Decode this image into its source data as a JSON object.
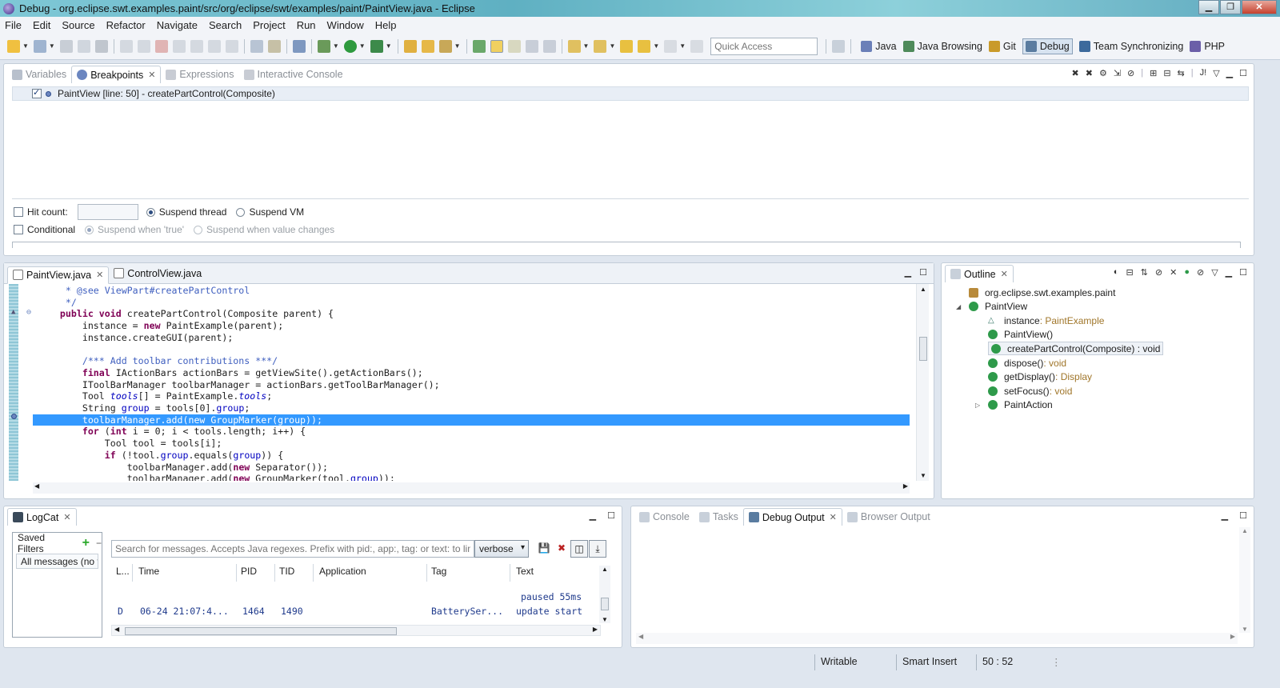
{
  "window": {
    "title": "Debug - org.eclipse.swt.examples.paint/src/org/eclipse/swt/examples/paint/PaintView.java - Eclipse",
    "controls": [
      "▁",
      "❐",
      "✕"
    ]
  },
  "menu": [
    "File",
    "Edit",
    "Source",
    "Refactor",
    "Navigate",
    "Search",
    "Project",
    "Run",
    "Window",
    "Help"
  ],
  "toolbar": {
    "quick_access_placeholder": "Quick Access",
    "perspectives": [
      {
        "label": "Java",
        "color": "#6a7fb8"
      },
      {
        "label": "Java Browsing",
        "color": "#4e8a5a"
      },
      {
        "label": "Git",
        "color": "#c99a2a"
      },
      {
        "label": "Debug",
        "color": "#5a7ca0"
      },
      {
        "label": "Team Synchronizing",
        "color": "#3d6a9c"
      },
      {
        "label": "PHP",
        "color": "#6b5fa8"
      }
    ],
    "active_perspective": "Debug"
  },
  "debug_views": {
    "tabs": [
      {
        "label": "Variables",
        "icon": "variables-icon",
        "active": false
      },
      {
        "label": "Breakpoints",
        "icon": "breakpoints-icon",
        "active": true
      },
      {
        "label": "Expressions",
        "icon": "expressions-icon",
        "active": false
      },
      {
        "label": "Interactive Console",
        "icon": "console-icon",
        "active": false
      }
    ],
    "breakpoint": {
      "label": "PaintView [line: 50] - createPartControl(Composite)",
      "checked": true
    },
    "options": {
      "hit_count_label": "Hit count:",
      "suspend_thread": "Suspend thread",
      "suspend_vm": "Suspend VM",
      "conditional": "Conditional",
      "suspend_true": "Suspend when 'true'",
      "suspend_change": "Suspend when value changes"
    }
  },
  "editor": {
    "tabs": [
      {
        "label": "PaintView.java",
        "active": true
      },
      {
        "label": "ControlView.java",
        "active": false
      }
    ],
    "lines": [
      "     * @see ViewPart#createPartControl",
      "     */",
      "    public void createPartControl(Composite parent) {",
      "        instance = new PaintExample(parent);",
      "        instance.createGUI(parent);",
      "",
      "        /*** Add toolbar contributions ***/",
      "        final IActionBars actionBars = getViewSite().getActionBars();",
      "        IToolBarManager toolbarManager = actionBars.getToolBarManager();",
      "        Tool tools[] = PaintExample.tools;",
      "        String group = tools[0].group;",
      "        toolbarManager.add(new GroupMarker(group));",
      "        for (int i = 0; i < tools.length; i++) {",
      "            Tool tool = tools[i];",
      "            if (!tool.group.equals(group)) {",
      "                toolbarManager.add(new Separator());",
      "                toolbarManager.add(new GroupMarker(tool.group));"
    ],
    "highlighted_line": 11
  },
  "outline": {
    "tab": "Outline",
    "items": [
      {
        "label": "org.eclipse.swt.examples.paint",
        "type": "",
        "indent": 0,
        "icon": "package-icon",
        "color": "#b88a3a"
      },
      {
        "label": "PaintView",
        "type": "",
        "indent": 0,
        "icon": "class-icon",
        "color": "#2e9a4a",
        "expander": "◢"
      },
      {
        "label": "instance",
        "type": " : PaintExample",
        "indent": 1,
        "icon": "field-icon",
        "color": "#3a7a6a"
      },
      {
        "label": "PaintView()",
        "type": "",
        "indent": 1,
        "icon": "constructor-icon",
        "color": "#2e9a4a"
      },
      {
        "label": "createPartControl(Composite) : void",
        "type": "",
        "indent": 1,
        "icon": "method-icon",
        "color": "#2e9a4a",
        "selected": true
      },
      {
        "label": "dispose()",
        "type": " : void",
        "indent": 1,
        "icon": "method-icon",
        "color": "#2e9a4a"
      },
      {
        "label": "getDisplay()",
        "type": " : Display",
        "indent": 1,
        "icon": "method-icon",
        "color": "#2e9a4a"
      },
      {
        "label": "setFocus()",
        "type": " : void",
        "indent": 1,
        "icon": "method-icon",
        "color": "#2e9a4a"
      },
      {
        "label": "PaintAction",
        "type": "",
        "indent": 1,
        "icon": "class-icon",
        "color": "#2e9a4a",
        "expander": "▷"
      }
    ]
  },
  "logcat": {
    "tab": "LogCat",
    "saved_filters": "Saved Filters",
    "filter_item": "All messages (no filters)",
    "search_placeholder": "Search for messages. Accepts Java regexes. Prefix with pid:, app:, tag: or text: to limit scope.",
    "level": "verbose",
    "columns": [
      "L...",
      "Time",
      "PID",
      "TID",
      "Application",
      "Tag",
      "Text"
    ],
    "rows": [
      {
        "level": "",
        "time": "",
        "pid": "",
        "tid": "",
        "app": "",
        "tag": "",
        "text": "paused 55ms"
      },
      {
        "level": "D",
        "time": "06-24 21:07:4...",
        "pid": "1464",
        "tid": "1490",
        "app": "",
        "tag": "BatterySer...",
        "text": "update start"
      }
    ]
  },
  "bottom_right": {
    "tabs": [
      {
        "label": "Console",
        "active": false
      },
      {
        "label": "Tasks",
        "active": false
      },
      {
        "label": "Debug Output",
        "active": true
      },
      {
        "label": "Browser Output",
        "active": false
      }
    ]
  },
  "status": {
    "writable": "Writable",
    "insert_mode": "Smart Insert",
    "position": "50 : 52"
  }
}
